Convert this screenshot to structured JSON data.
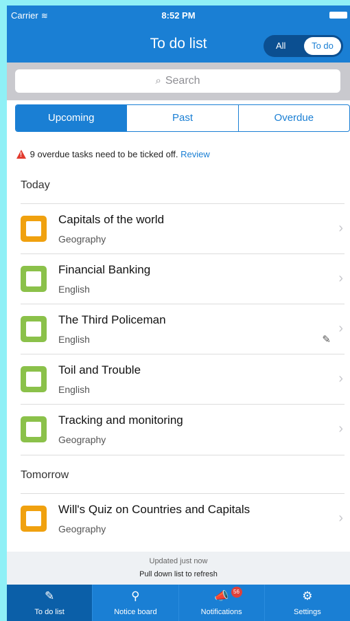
{
  "status_bar": {
    "carrier": "Carrier",
    "time": "8:52 PM"
  },
  "header": {
    "title": "To do list",
    "toggle": {
      "all": "All",
      "todo": "To do",
      "selected": "To do"
    }
  },
  "search": {
    "placeholder": "Search"
  },
  "tabs": [
    {
      "label": "Upcoming",
      "active": true
    },
    {
      "label": "Past",
      "active": false
    },
    {
      "label": "Overdue",
      "active": false
    }
  ],
  "warning": {
    "text": "9 overdue tasks need to be ticked off.",
    "link": "Review"
  },
  "sections": {
    "today": {
      "label": "Today",
      "items": [
        {
          "title": "Capitals of the world",
          "subject": "Geography",
          "color": "#f0a10f"
        },
        {
          "title": "Financial Banking",
          "subject": "English",
          "color": "#8bc14a"
        },
        {
          "title": "The Third Policeman",
          "subject": "English",
          "color": "#8bc14a",
          "attachment": true
        },
        {
          "title": "Toil and Trouble",
          "subject": "English",
          "color": "#8bc14a"
        },
        {
          "title": "Tracking and monitoring",
          "subject": "Geography",
          "color": "#8bc14a"
        }
      ]
    },
    "tomorrow": {
      "label": "Tomorrow",
      "items": [
        {
          "title": "Will's Quiz on Countries and Capitals",
          "subject": "Geography",
          "color": "#f0a10f"
        }
      ]
    }
  },
  "refresh": {
    "updated": "Updated just now",
    "hint": "Pull down list to refresh"
  },
  "tabbar": {
    "items": [
      {
        "label": "To do list",
        "icon": "edit-icon",
        "active": true
      },
      {
        "label": "Notice board",
        "icon": "pin-icon",
        "active": false
      },
      {
        "label": "Notifications",
        "icon": "megaphone-icon",
        "badge": "56",
        "active": false
      },
      {
        "label": "Settings",
        "icon": "gear-icon",
        "active": false
      }
    ]
  },
  "colors": {
    "primary": "#1a7fd4",
    "overdue": "#e23b2e",
    "geography": "#f0a10f",
    "english": "#8bc14a"
  }
}
